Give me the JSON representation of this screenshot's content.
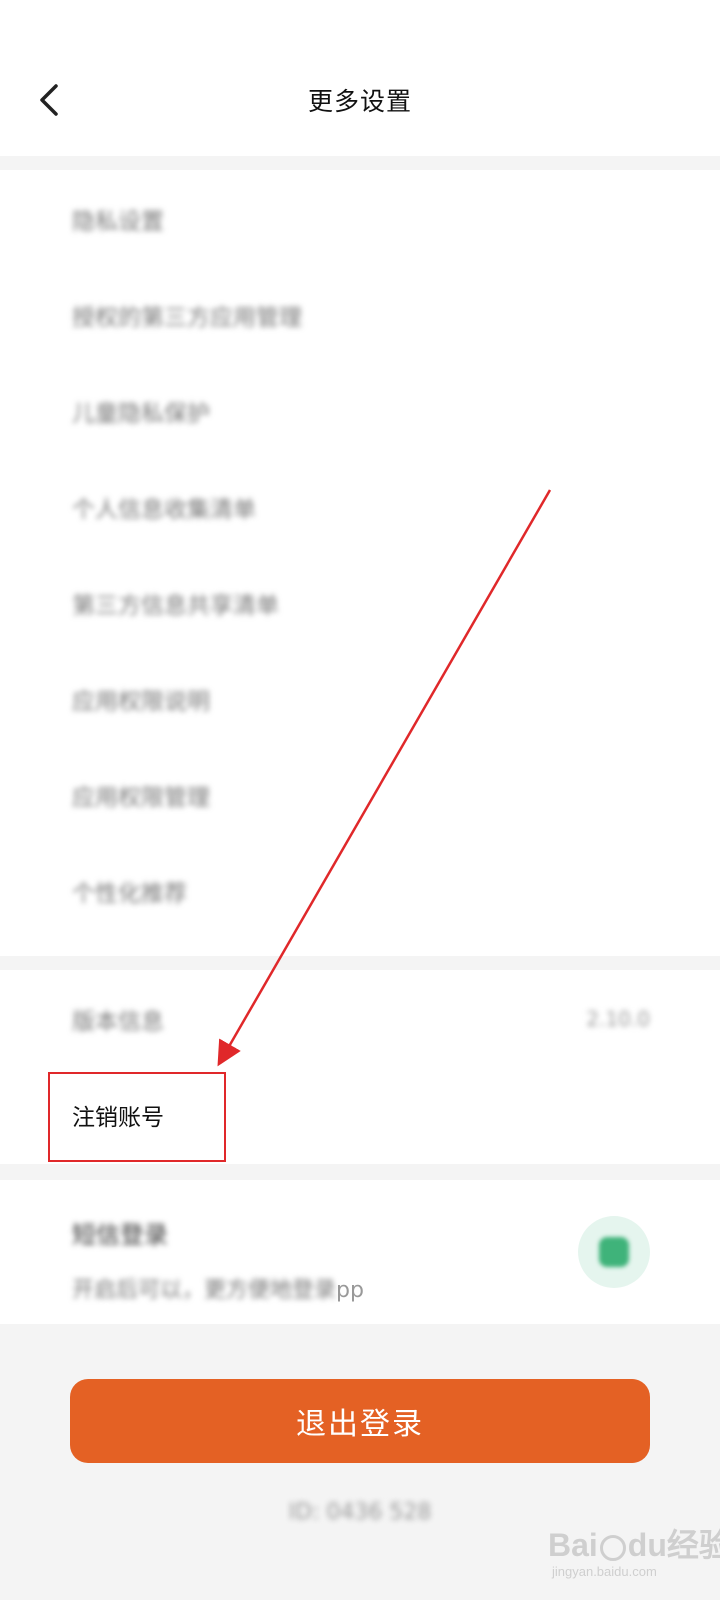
{
  "header": {
    "title": "更多设置"
  },
  "menu_items": [
    {
      "label": "隐私设置"
    },
    {
      "label": "授权的第三方应用管理"
    },
    {
      "label": "儿童隐私保护"
    },
    {
      "label": "个人信息收集清单"
    },
    {
      "label": "第三方信息共享清单"
    },
    {
      "label": "应用权限说明"
    },
    {
      "label": "应用权限管理"
    },
    {
      "label": "个性化推荐"
    }
  ],
  "account": {
    "version_label": "版本信息",
    "version_value": "2.10.0",
    "deactivate_label": "注销账号"
  },
  "setting": {
    "title": "短信登录",
    "desc_blurred": "开启后可以，更方便地登录",
    "desc_tail": "pp",
    "toggle_on": true,
    "toggle_color": "#3fb37a"
  },
  "logout": {
    "label": "退出登录",
    "color": "#e46124"
  },
  "footer": {
    "text": "ID: 0436 528"
  },
  "annotation": {
    "color": "#e0282a"
  },
  "watermark": {
    "main_a": "Bai",
    "main_b": "du",
    "main_c": "经验",
    "sub": "jingyan.baidu.com"
  }
}
